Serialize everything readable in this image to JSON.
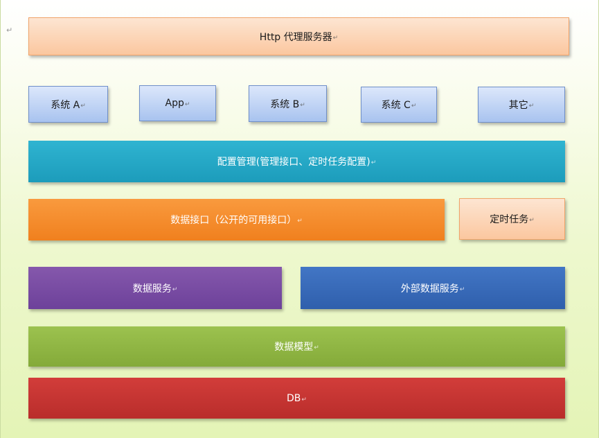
{
  "return_mark": "↵",
  "blocks": {
    "http_proxy": {
      "label": "Http 代理服务器",
      "mark": "↵"
    },
    "system_a": {
      "label": "系统 A",
      "mark": "↵"
    },
    "app": {
      "label": "App",
      "mark": "↵"
    },
    "system_b": {
      "label": "系统 B",
      "mark": "↵"
    },
    "system_c": {
      "label": "系统 C",
      "mark": "↵"
    },
    "others": {
      "label": "其它",
      "mark": "↵"
    },
    "config_management": {
      "label": "配置管理(管理接口、定时任务配置)",
      "mark": "↵"
    },
    "data_interface": {
      "label": "数据接口（公开的可用接口）",
      "mark": "↵"
    },
    "scheduled_tasks": {
      "label": "定时任务",
      "mark": "↵"
    },
    "data_service": {
      "label": "数据服务",
      "mark": "↵"
    },
    "external_data_service": {
      "label": "外部数据服务",
      "mark": "↵"
    },
    "data_model": {
      "label": "数据模型",
      "mark": "↵"
    },
    "db": {
      "label": "DB",
      "mark": "↵"
    }
  },
  "colors": {
    "proxy": "#fbc79f",
    "clients": "#a8c3ef",
    "config": "#1c9cbb",
    "interface": "#f0801e",
    "data_service": "#6d419a",
    "external_service": "#2f5fac",
    "model": "#84aa39",
    "db": "#b92d2b"
  }
}
